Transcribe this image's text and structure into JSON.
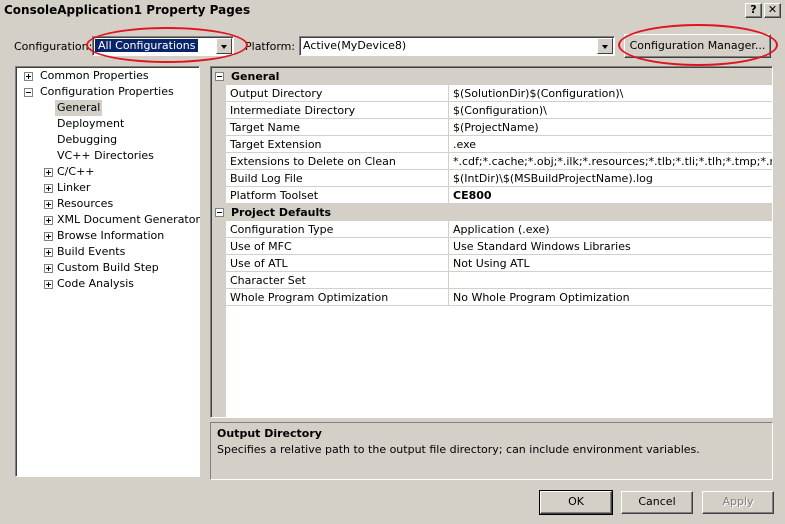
{
  "window": {
    "title": "ConsoleApplication1 Property Pages",
    "help_label": "?",
    "close_label": "✕"
  },
  "config_bar": {
    "configuration_label": "Configuration:",
    "configuration_value": "All Configurations",
    "platform_label": "Platform:",
    "platform_value": "Active(MyDevice8)",
    "config_manager_label": "Configuration Manager..."
  },
  "tree": {
    "items": [
      {
        "label": "Common Properties",
        "expander": "plus"
      },
      {
        "label": "Configuration Properties",
        "expander": "minus"
      },
      {
        "label": "General",
        "expander": "none"
      },
      {
        "label": "Deployment",
        "expander": "none"
      },
      {
        "label": "Debugging",
        "expander": "none"
      },
      {
        "label": "VC++ Directories",
        "expander": "none"
      },
      {
        "label": "C/C++",
        "expander": "plus"
      },
      {
        "label": "Linker",
        "expander": "plus"
      },
      {
        "label": "Resources",
        "expander": "plus"
      },
      {
        "label": "XML Document Generator",
        "expander": "plus"
      },
      {
        "label": "Browse Information",
        "expander": "plus"
      },
      {
        "label": "Build Events",
        "expander": "plus"
      },
      {
        "label": "Custom Build Step",
        "expander": "plus"
      },
      {
        "label": "Code Analysis",
        "expander": "plus"
      }
    ]
  },
  "grid": {
    "general": {
      "category": "General",
      "rows": [
        {
          "name": "Output Directory",
          "value": "$(SolutionDir)$(Configuration)\\"
        },
        {
          "name": "Intermediate Directory",
          "value": "$(Configuration)\\"
        },
        {
          "name": "Target Name",
          "value": "$(ProjectName)"
        },
        {
          "name": "Target Extension",
          "value": ".exe"
        },
        {
          "name": "Extensions to Delete on Clean",
          "value": "*.cdf;*.cache;*.obj;*.ilk;*.resources;*.tlb;*.tli;*.tlh;*.tmp;*.rsp;"
        },
        {
          "name": "Build Log File",
          "value": "$(IntDir)\\$(MSBuildProjectName).log"
        },
        {
          "name": "Platform Toolset",
          "value": "CE800"
        }
      ]
    },
    "defaults": {
      "category": "Project Defaults",
      "rows": [
        {
          "name": "Configuration Type",
          "value": "Application (.exe)"
        },
        {
          "name": "Use of MFC",
          "value": "Use Standard Windows Libraries"
        },
        {
          "name": "Use of ATL",
          "value": "Not Using ATL"
        },
        {
          "name": "Character Set",
          "value": ""
        },
        {
          "name": "Whole Program Optimization",
          "value": "No Whole Program Optimization"
        }
      ]
    }
  },
  "description": {
    "title": "Output Directory",
    "text": "Specifies a relative path to the output file directory; can include environment variables."
  },
  "buttons": {
    "ok": "OK",
    "cancel": "Cancel",
    "apply": "Apply"
  },
  "colors": {
    "annotation_red": "#e0141e",
    "selection_blue": "#0a246a"
  }
}
